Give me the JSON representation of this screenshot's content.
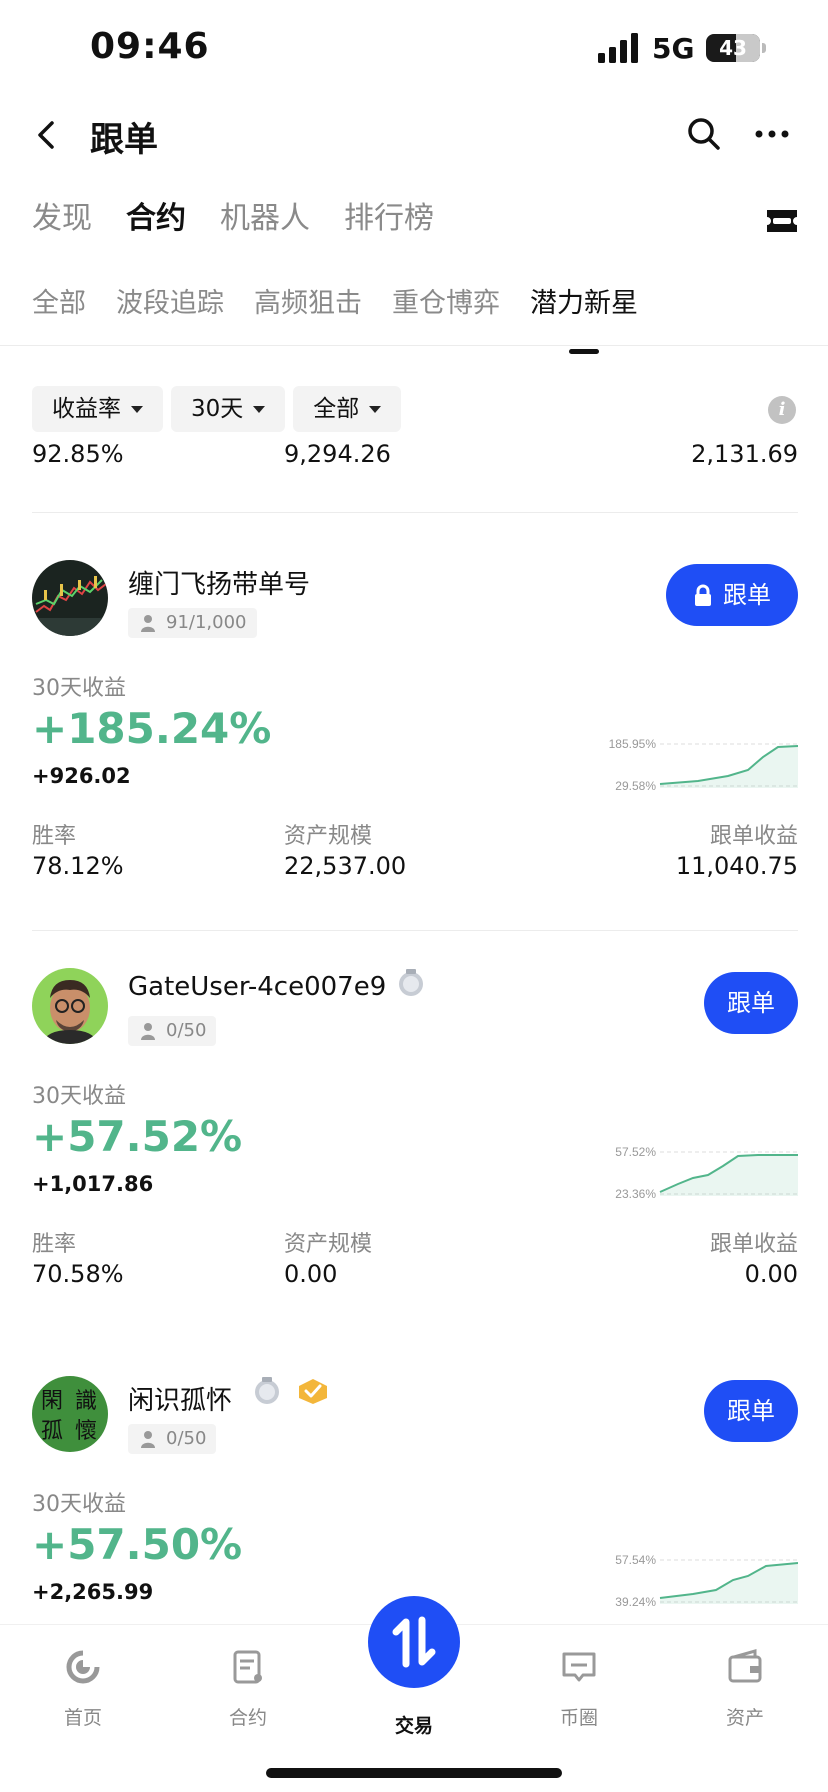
{
  "status_bar": {
    "time": "09:46",
    "network": "5G",
    "battery": "43"
  },
  "header": {
    "title": "跟单"
  },
  "main_tabs": [
    {
      "label": "发现",
      "active": false
    },
    {
      "label": "合约",
      "active": true
    },
    {
      "label": "机器人",
      "active": false
    },
    {
      "label": "排行榜",
      "active": false
    }
  ],
  "sub_tabs": [
    {
      "label": "全部",
      "active": false
    },
    {
      "label": "波段追踪",
      "active": false
    },
    {
      "label": "高频狙击",
      "active": false
    },
    {
      "label": "重仓博弈",
      "active": false
    },
    {
      "label": "潜力新星",
      "active": true
    }
  ],
  "filters": [
    {
      "label": "收益率"
    },
    {
      "label": "30天"
    },
    {
      "label": "全部"
    }
  ],
  "summary": {
    "v1": "92.85%",
    "v2": "9,294.26",
    "v3": "2,131.69"
  },
  "traders": [
    {
      "name": "缠门飞扬带单号",
      "followers": "91/1,000",
      "follow_label": "跟单",
      "locked": true,
      "roi_label": "30天收益",
      "roi": "+185.24%",
      "pnl": "+926.02",
      "spark_max": "185.95%",
      "spark_min": "29.58%",
      "win_rate_label": "胜率",
      "win_rate": "78.12%",
      "aum_label": "资产规模",
      "aum": "22,537.00",
      "copy_pnl_label": "跟单收益",
      "copy_pnl": "11,040.75"
    },
    {
      "name": "GateUser-4ce007e9",
      "followers": "0/50",
      "follow_label": "跟单",
      "locked": false,
      "roi_label": "30天收益",
      "roi": "+57.52%",
      "pnl": "+1,017.86",
      "spark_max": "57.52%",
      "spark_min": "23.36%",
      "win_rate_label": "胜率",
      "win_rate": "70.58%",
      "aum_label": "资产规模",
      "aum": "0.00",
      "copy_pnl_label": "跟单收益",
      "copy_pnl": "0.00"
    },
    {
      "name": "闲识孤怀",
      "followers": "0/50",
      "follow_label": "跟单",
      "locked": false,
      "roi_label": "30天收益",
      "roi": "+57.50%",
      "pnl": "+2,265.99",
      "spark_max": "57.54%",
      "spark_min": "39.24%",
      "avatar_text": "閑識孤懷"
    }
  ],
  "bottom_nav": [
    {
      "label": "首页",
      "icon": "home-icon"
    },
    {
      "label": "合约",
      "icon": "contract-icon"
    },
    {
      "label": "交易",
      "icon": "trade-icon",
      "active": true
    },
    {
      "label": "币圈",
      "icon": "community-icon"
    },
    {
      "label": "资产",
      "icon": "wallet-icon"
    }
  ],
  "colors": {
    "accent": "#1f4ef5",
    "profit": "#52b58b"
  }
}
